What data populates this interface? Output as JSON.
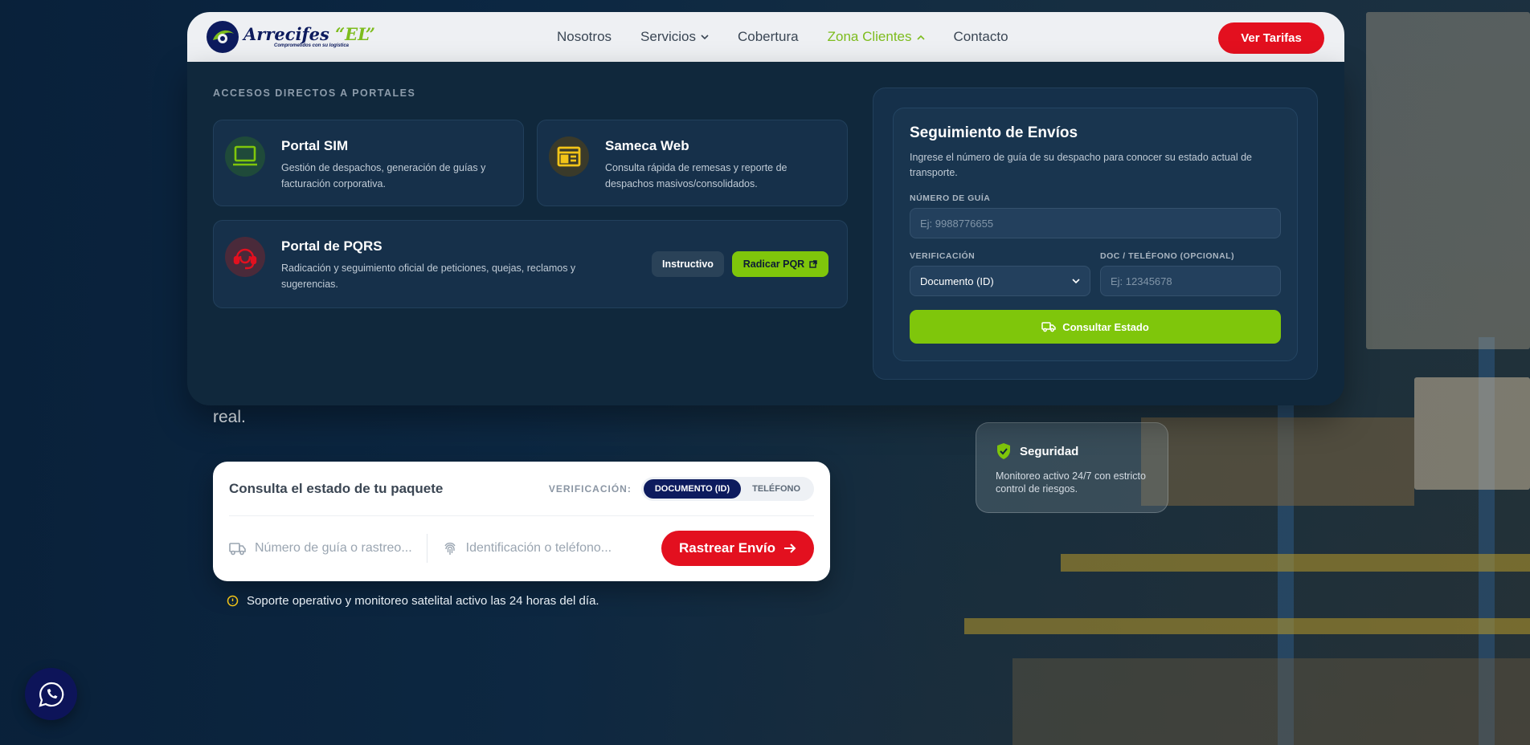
{
  "brand": {
    "name": "Arrecifes",
    "name_suffix": "“EL”",
    "tagline": "Comprometidos con su logística"
  },
  "nav": {
    "items": [
      {
        "label": "Nosotros"
      },
      {
        "label": "Servicios"
      },
      {
        "label": "Cobertura"
      },
      {
        "label": "Zona Clientes"
      },
      {
        "label": "Contacto"
      }
    ],
    "cta_label": "Ver Tarifas"
  },
  "mega_menu": {
    "section_label": "ACCESOS DIRECTOS A PORTALES",
    "portals": [
      {
        "title": "Portal SIM",
        "description": "Gestión de despachos, generación de guías y facturación corporativa.",
        "icon": "laptop-icon"
      },
      {
        "title": "Sameca Web",
        "description": "Consulta rápida de remesas y reporte de despachos masivos/consolidados.",
        "icon": "web-window-icon"
      },
      {
        "title": "Portal de PQRS",
        "description": "Radicación y seguimiento oficial de peticiones, quejas, reclamos y sugerencias.",
        "icon": "support-agent-icon",
        "secondary_button": "Instructivo",
        "primary_button": "Radicar PQR"
      }
    ],
    "tracking": {
      "title": "Seguimiento de Envíos",
      "description": "Ingrese el número de guía de su despacho para conocer su estado actual de transporte.",
      "guide_label": "NÚMERO DE GUÍA",
      "guide_placeholder": "Ej: 9988776655",
      "verification_label": "VERIFICACIÓN",
      "verification_value": "Documento (ID)",
      "doc_label": "DOC / TELÉFONO (OPCIONAL)",
      "doc_placeholder": "Ej: 12345678",
      "button_label": "Consultar Estado"
    }
  },
  "hero": {
    "tail_text": "real.",
    "tracker": {
      "title": "Consulta el estado de tu paquete",
      "verification_label": "VERIFICACIÓN:",
      "toggle_document": "DOCUMENTO (ID)",
      "toggle_phone": "TELÉFONO",
      "guide_placeholder": "Número de guía o rastreo...",
      "id_placeholder": "Identificación o teléfono...",
      "button_label": "Rastrear Envío"
    },
    "support_text": "Soporte operativo y monitoreo satelital activo las 24 horas del día."
  },
  "security_card": {
    "title": "Seguridad",
    "text": "Monitoreo activo 24/7 con estricto control de riesgos."
  },
  "colors": {
    "brand_navy": "#0d1b5e",
    "accent_red": "#e3101f",
    "accent_green": "#7fc60b",
    "menu_bg": "#10283c"
  }
}
